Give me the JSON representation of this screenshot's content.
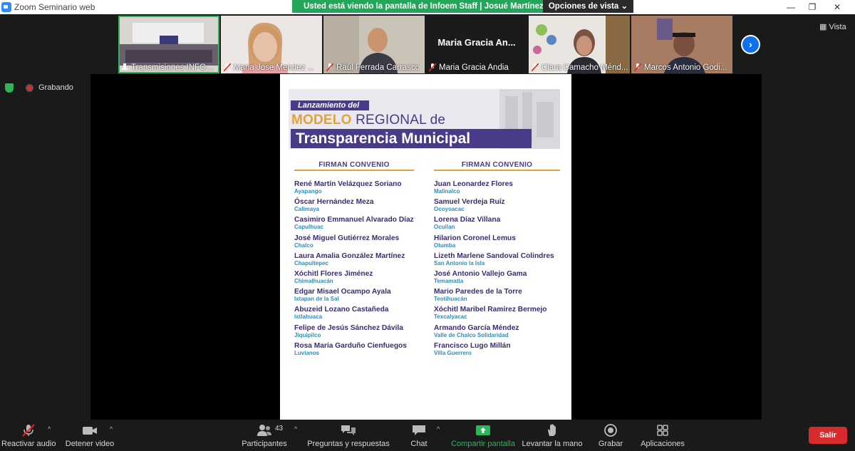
{
  "window": {
    "title": "Zoom Seminario web",
    "minimize": "—",
    "restore": "❐",
    "close": "✕"
  },
  "share_banner": {
    "text": "Usted está viendo la pantalla de Infoem Staff | Josué Martínez ...",
    "view_options": "Opciones de vista ⌄"
  },
  "thumbnails": [
    {
      "name": "Transmisiones INFOEM",
      "muted": false,
      "active": true
    },
    {
      "name": "Maria Jose Mendez ...",
      "muted": true
    },
    {
      "name": "Raúl Ferrada Carrasco",
      "muted": true
    },
    {
      "name": "Maria Gracia Andia",
      "muted": true,
      "display": "Maria Gracia An..."
    },
    {
      "name": "Clara Camacho Ménd...",
      "muted": true
    },
    {
      "name": "Marcos Antonio Godi...",
      "muted": true
    }
  ],
  "next_arrow": "›",
  "vista": "Vista",
  "recording": "Grabando",
  "colors": {
    "accent_green": "#23a659",
    "purple": "#4a3a8a",
    "gold": "#e1a23c",
    "teal": "#2e8fb6",
    "red": "#d82c2c"
  },
  "document": {
    "lanzamiento": "Lanzamiento del",
    "modelo_bold": "MODELO",
    "modelo_rest": " REGIONAL de",
    "transparencia": "Transparencia Municipal",
    "columns": [
      {
        "heading": "FIRMAN CONVENIO",
        "signers": [
          {
            "person": "René Martín Velázquez Soriano",
            "municipality": "Ayapango"
          },
          {
            "person": "Óscar Hernández Meza",
            "municipality": "Calimaya"
          },
          {
            "person": "Casimiro Emmanuel Alvarado Díaz",
            "municipality": "Capulhuac"
          },
          {
            "person": "José Miguel Gutiérrez Morales",
            "municipality": "Chalco"
          },
          {
            "person": "Laura Amalia González Martínez",
            "municipality": "Chapultepec"
          },
          {
            "person": "Xóchitl Flores Jiménez",
            "municipality": "Chimalhuacán"
          },
          {
            "person": "Edgar Misael Ocampo Ayala",
            "municipality": "Ixtapan de la Sal"
          },
          {
            "person": "Abuzeid Lozano Castañeda",
            "municipality": "Ixtlahuaca"
          },
          {
            "person": "Felipe de Jesús Sánchez Dávila",
            "municipality": "Jiquipilco"
          },
          {
            "person": "Rosa María Garduño Cienfuegos",
            "municipality": "Luvianos"
          }
        ]
      },
      {
        "heading": "FIRMAN CONVENIO",
        "signers": [
          {
            "person": "Juan Leonardez Flores",
            "municipality": "Malinalco"
          },
          {
            "person": "Samuel Verdeja Ruíz",
            "municipality": "Ocoyoacac"
          },
          {
            "person": "Lorena Díaz Villana",
            "municipality": "Ocuilan"
          },
          {
            "person": "Hilarion Coronel Lemus",
            "municipality": "Otumba"
          },
          {
            "person": "Lizeth Marlene Sandoval Colindres",
            "municipality": "San Antonio la Isla"
          },
          {
            "person": "José Antonio Vallejo Gama",
            "municipality": "Temamatla"
          },
          {
            "person": "Mario Paredes de la Torre",
            "municipality": "Teotihuacán"
          },
          {
            "person": "Xóchitl Maribel Ramírez Bermejo",
            "municipality": "Texcalyacac"
          },
          {
            "person": "Armando García Méndez",
            "municipality": "Valle de Chalco Solidaridad"
          },
          {
            "person": "Francisco Lugo Millán",
            "municipality": "Villa Guerrero"
          }
        ]
      }
    ]
  },
  "toolbar": {
    "audio": "Reactivar audio",
    "video": "Detener video",
    "participants": "Participantes",
    "participants_count": "43",
    "qa": "Preguntas y respuestas",
    "chat": "Chat",
    "share": "Compartir pantalla",
    "raise_hand": "Levantar la mano",
    "record": "Grabar",
    "apps": "Aplicaciones",
    "leave": "Salir",
    "caret": "^"
  }
}
